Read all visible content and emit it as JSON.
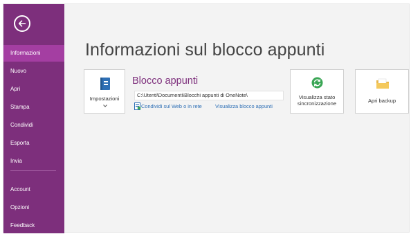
{
  "sidebar": {
    "back_icon": "back-arrow-icon",
    "items": [
      {
        "label": "Informazioni",
        "active": true
      },
      {
        "label": "Nuovo"
      },
      {
        "label": "Apri"
      },
      {
        "label": "Stampa"
      },
      {
        "label": "Condividi"
      },
      {
        "label": "Esporta"
      },
      {
        "label": "Invia"
      }
    ],
    "bottom_items": [
      {
        "label": "Account"
      },
      {
        "label": "Opzioni"
      },
      {
        "label": "Feedback"
      }
    ]
  },
  "main": {
    "title": "Informazioni sul blocco appunti",
    "settings_tile": {
      "label": "Impostazioni",
      "icon": "notebook-icon"
    },
    "notebook": {
      "name": "Blocco appunti",
      "path": "C:\\Utenti\\Documenti\\Blocchi appunti di OneNote\\",
      "share_link": "Condividi sul Web o in rete",
      "view_link": "Visualizza blocco appunti"
    },
    "sync_tile": {
      "line1": "Visualizza stato",
      "line2": "sincronizzazione",
      "icon": "sync-icon"
    },
    "backup_tile": {
      "label": "Apri backup",
      "icon": "folder-icon"
    }
  },
  "colors": {
    "sidebar": "#7d2f7c",
    "sidebar_active": "#a43ea2",
    "accent_text": "#7d2f7c",
    "link": "#2e6fb5",
    "sync_green": "#3aa655",
    "folder_yellow": "#f4c95d"
  }
}
